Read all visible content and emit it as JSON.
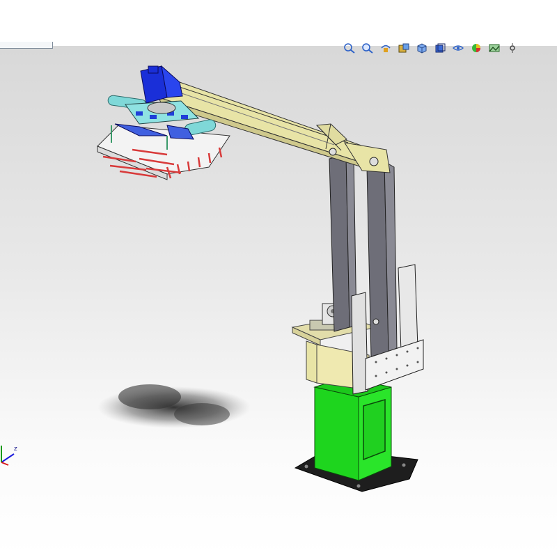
{
  "toolbar": {
    "buttons": [
      {
        "icon": "zoom-to-fit-icon"
      },
      {
        "icon": "zoom-to-area-icon"
      },
      {
        "icon": "previous-view-icon"
      },
      {
        "icon": "section-view-icon"
      },
      {
        "icon": "view-orientation-icon"
      },
      {
        "icon": "display-style-icon"
      },
      {
        "icon": "hide-show-items-icon"
      },
      {
        "icon": "edit-appearance-icon"
      },
      {
        "icon": "apply-scene-icon"
      },
      {
        "icon": "view-settings-icon"
      }
    ]
  },
  "triad": {
    "z_label": "z"
  },
  "colors": {
    "base": "#1ed51e",
    "arm": "#e8e4a6",
    "column": "#6e6e78",
    "gripper_blue": "#1a2fd8",
    "gripper_cyan": "#7fd8d8",
    "background_top": "#d8d8d8"
  }
}
